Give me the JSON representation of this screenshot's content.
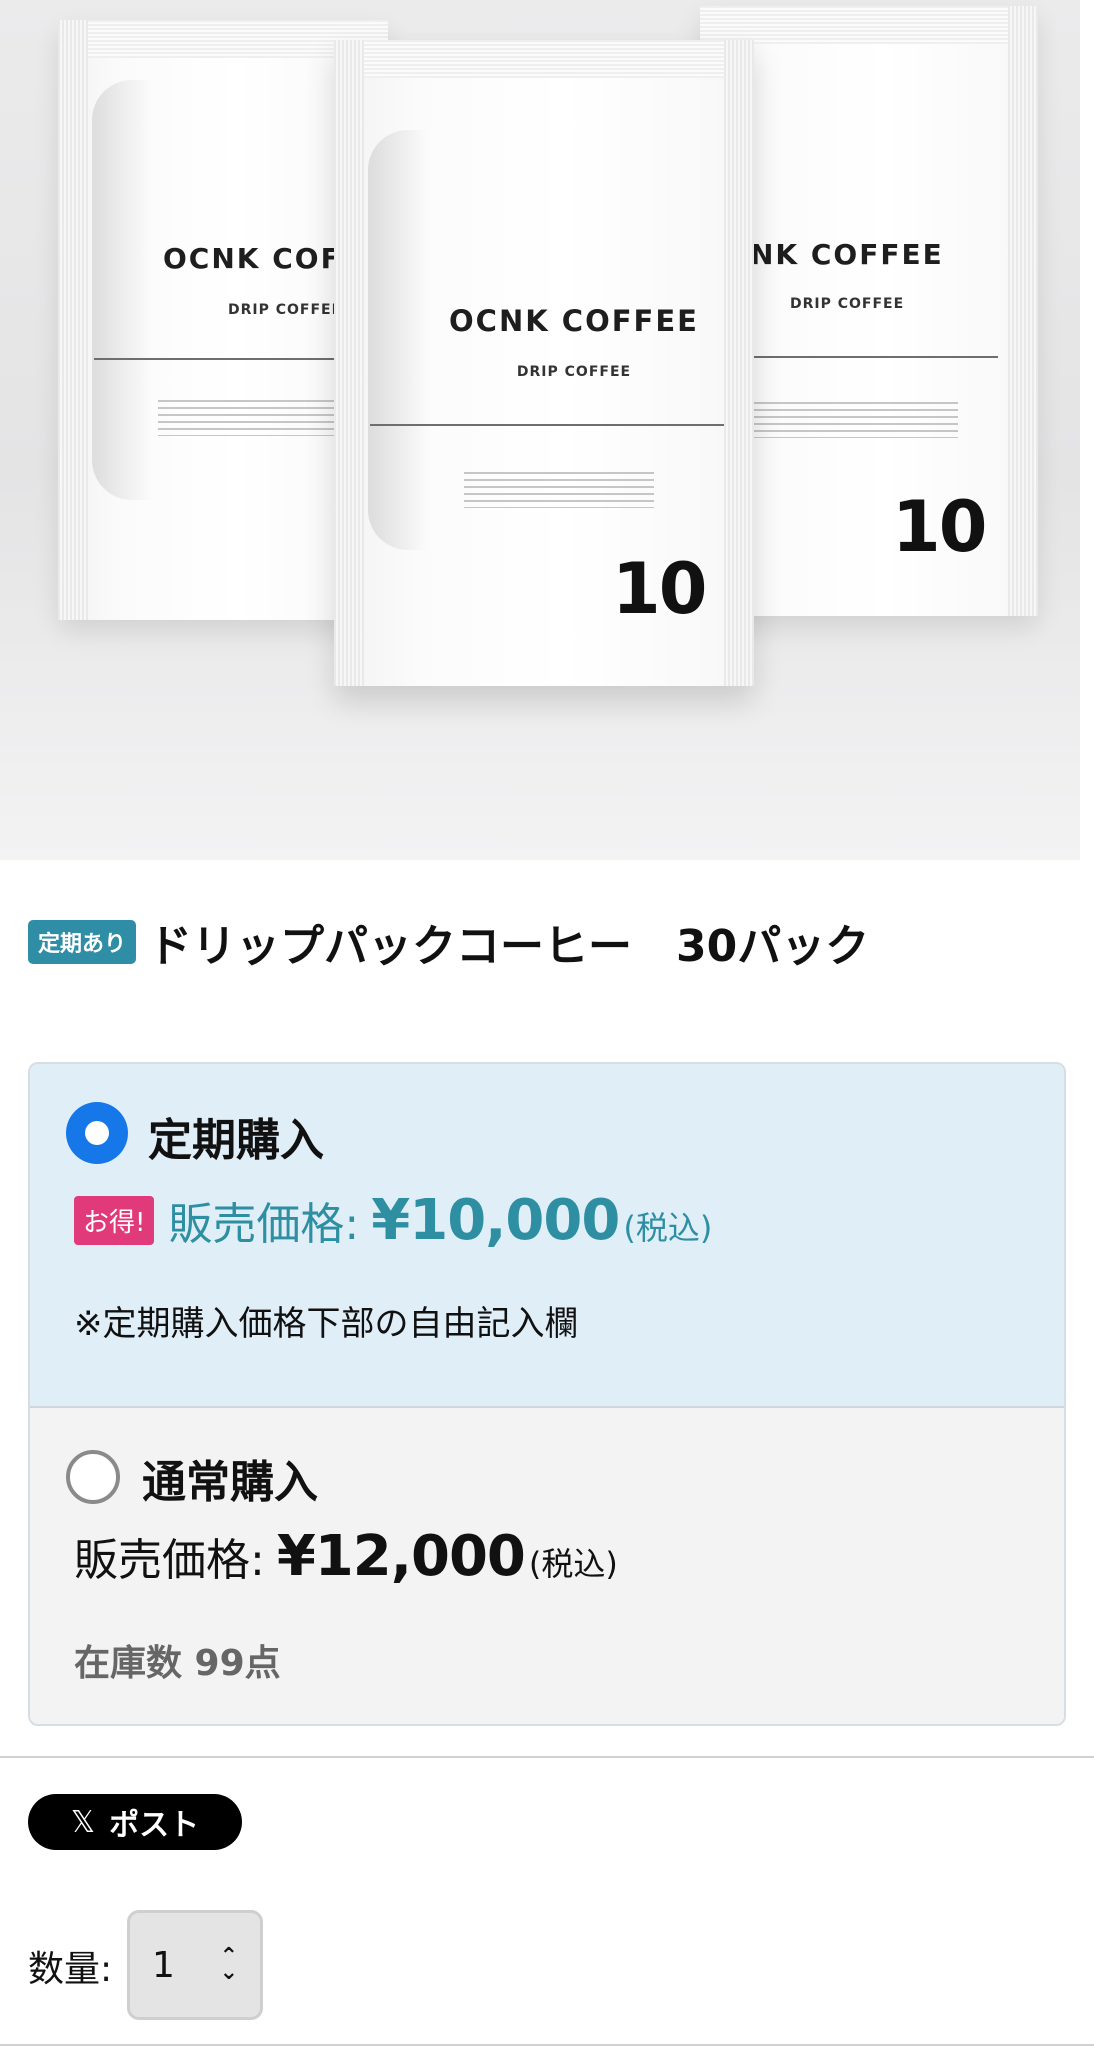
{
  "hero": {
    "bags": [
      {
        "brand": "OCNK COF",
        "sub": "DRIP COFFEE",
        "number": ""
      },
      {
        "brand": "NK COFFEE",
        "sub": "DRIP COFFEE",
        "number": "10"
      },
      {
        "brand": "OCNK COFFEE",
        "sub": "DRIP COFFEE",
        "number": "10"
      }
    ]
  },
  "product": {
    "badge": "定期あり",
    "title": "ドリップパックコーヒー　30パック"
  },
  "options": {
    "subscription": {
      "label": "定期購入",
      "selected": true,
      "deal_badge": "お得!",
      "price_label": "販売価格:",
      "price": "¥10,000",
      "tax": "(税込)",
      "note": "※定期購入価格下部の自由記入欄",
      "accent_color": "#2e8fa3"
    },
    "regular": {
      "label": "通常購入",
      "selected": false,
      "price_label": "販売価格:",
      "price": "¥12,000",
      "tax": "(税込)",
      "stock": "在庫数 99点"
    }
  },
  "share": {
    "icon": "x-logo-icon",
    "label": "ポスト"
  },
  "quantity": {
    "label": "数量:",
    "value": "1"
  },
  "colors": {
    "radio_selected": "#1677e8",
    "badge_teal": "#2f8ea5",
    "deal_pink": "#e03a7a",
    "subscription_bg": "#e0eef8"
  }
}
